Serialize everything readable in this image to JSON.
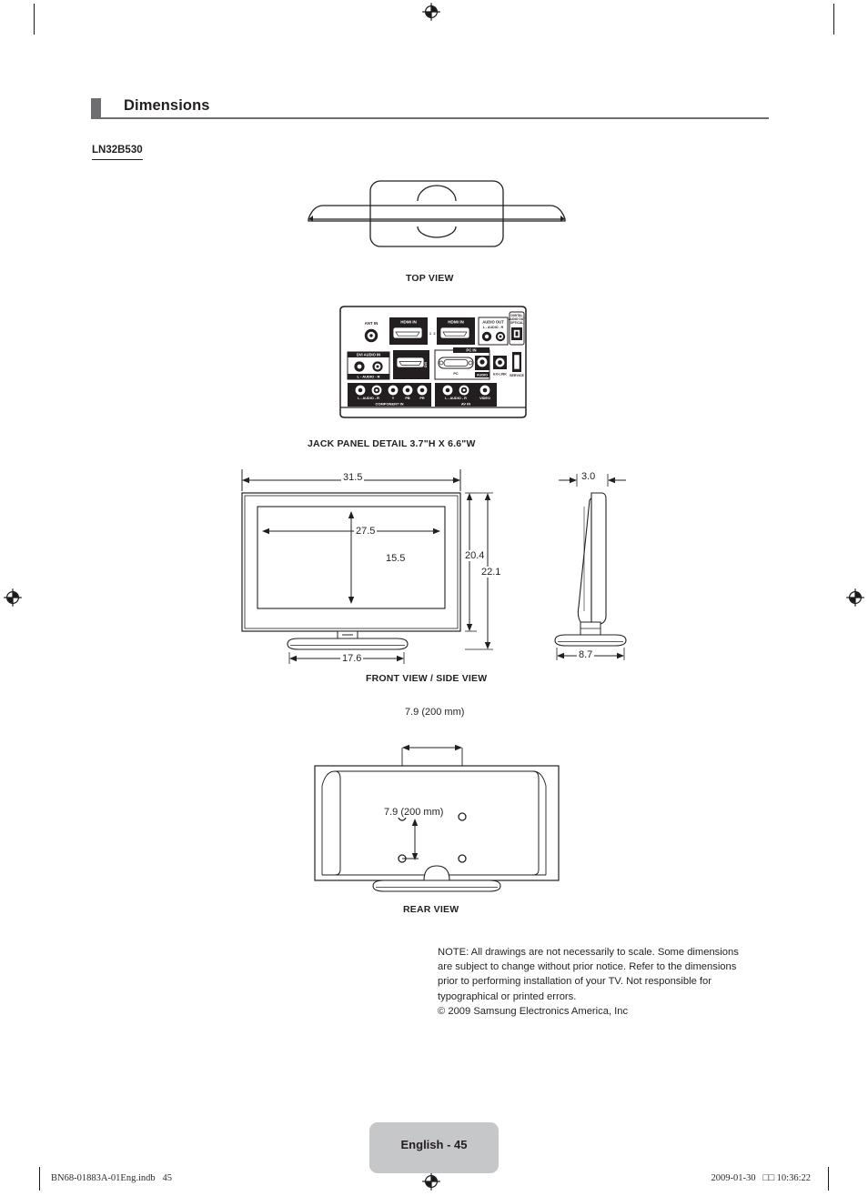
{
  "document": {
    "section_title": "Dimensions",
    "model_name": "LN32B530"
  },
  "views": {
    "top": {
      "caption": "TOP VIEW"
    },
    "jack_panel": {
      "caption": "JACK PANEL DETAIL 3.7\"H X 6.6\"W"
    },
    "front_side": {
      "caption": "FRONT VIEW / SIDE VIEW"
    },
    "rear": {
      "caption": "REAR VIEW"
    }
  },
  "dimensions": {
    "front_width_outer": "31.5",
    "front_screen_width": "27.5",
    "front_screen_height": "15.5",
    "front_height_panel": "20.4",
    "front_height_total": "22.1",
    "stand_width": "17.6",
    "side_panel_depth": "3.0",
    "side_stand_depth": "8.7",
    "vesa_horizontal": "7.9 (200 mm)",
    "vesa_vertical": "7.9 (200 mm)"
  },
  "jack_panel_labels": {
    "ant_in": "ANT IN",
    "hdmi_in_1": "HDMI IN",
    "hdmi_in_2": "HDMI IN",
    "audio_out": "AUDIO OUT",
    "digital_audio_out": "DIGITAL AUDIO OUT (OPTICAL)",
    "dvi_audio_in": "DVI AUDIO IN",
    "dvi_tag": "DVI",
    "pc_in": "PC IN",
    "pc": "PC",
    "audio": "AUDIO",
    "ex_link": "EX-LINK",
    "service": "SERVICE",
    "component_in": "COMPONENT IN",
    "av_in": "AV IN",
    "video": "VIDEO",
    "audio_lr": "AUDIO",
    "channel_l": "L",
    "channel_r": "R",
    "comp_y": "Y",
    "comp_pb": "PB",
    "comp_pr": "PR"
  },
  "note": {
    "body": "NOTE: All drawings are not necessarily to scale. Some dimensions are subject to change without prior notice. Refer to the dimensions prior to performing installation of your TV. Not responsible for typographical or printed errors.",
    "copyright": "© 2009 Samsung Electronics America, Inc"
  },
  "footer": {
    "page_label": "English - 45",
    "file_ref": "BN68-01883A-01Eng.indb   45",
    "timestamp": "2009-01-30   □□ 10:36:22"
  },
  "colors": {
    "header_accent": "#6e6e70",
    "text": "#231f20",
    "page_tag_bg": "#c6c7c9",
    "line": "#231f20"
  }
}
